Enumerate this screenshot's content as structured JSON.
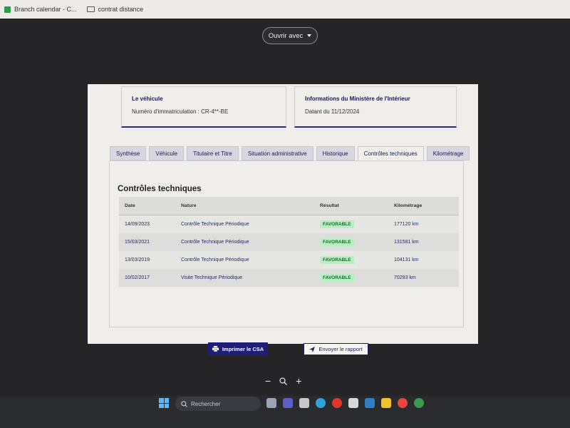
{
  "bookmarks": [
    {
      "label": "Branch calendar - C...",
      "icon": "spreadsheet-icon"
    },
    {
      "label": "contrat distance",
      "icon": "folder-icon"
    }
  ],
  "viewer": {
    "open_with_label": "Ouvrir avec"
  },
  "cards": {
    "vehicle_title": "Le véhicule",
    "vehicle_text": "Numéro d'immatriculation : CR-4**-BE",
    "ministry_title": "Informations du Ministère de l'Intérieur",
    "ministry_text": "Datant du 11/12/2024"
  },
  "tabs": [
    {
      "label": "Synthèse",
      "active": false
    },
    {
      "label": "Véhicule",
      "active": false
    },
    {
      "label": "Titulaire et Titre",
      "active": false
    },
    {
      "label": "Situation administrative",
      "active": false
    },
    {
      "label": "Historique",
      "active": false
    },
    {
      "label": "Contrôles techniques",
      "active": true
    },
    {
      "label": "Kilométrage",
      "active": false
    }
  ],
  "section_title": "Contrôles techniques",
  "table": {
    "headers": {
      "date": "Date",
      "nature": "Nature",
      "result": "Résultat",
      "mileage": "Kilométrage"
    },
    "rows": [
      {
        "date": "14/09/2023",
        "nature": "Contrôle Technique Périodique",
        "result": "FAVORABLE",
        "mileage": "177120 km"
      },
      {
        "date": "15/03/2021",
        "nature": "Contrôle Technique Périodique",
        "result": "FAVORABLE",
        "mileage": "131581 km"
      },
      {
        "date": "13/03/2019",
        "nature": "Contrôle Technique Périodique",
        "result": "FAVORABLE",
        "mileage": "104131 km"
      },
      {
        "date": "10/02/2017",
        "nature": "Visite Technique Périodique",
        "result": "FAVORABLE",
        "mileage": "70293 km"
      }
    ]
  },
  "buttons": {
    "print": "Imprimer le CSA",
    "send": "Envoyer le rapport"
  },
  "zoom": {
    "minus": "−",
    "plus": "+"
  },
  "taskbar": {
    "search_placeholder": "Rechercher"
  },
  "colors": {
    "accent": "#1e1e7a",
    "badge_bg": "#b8f0c4",
    "badge_text": "#1a6d2b"
  }
}
